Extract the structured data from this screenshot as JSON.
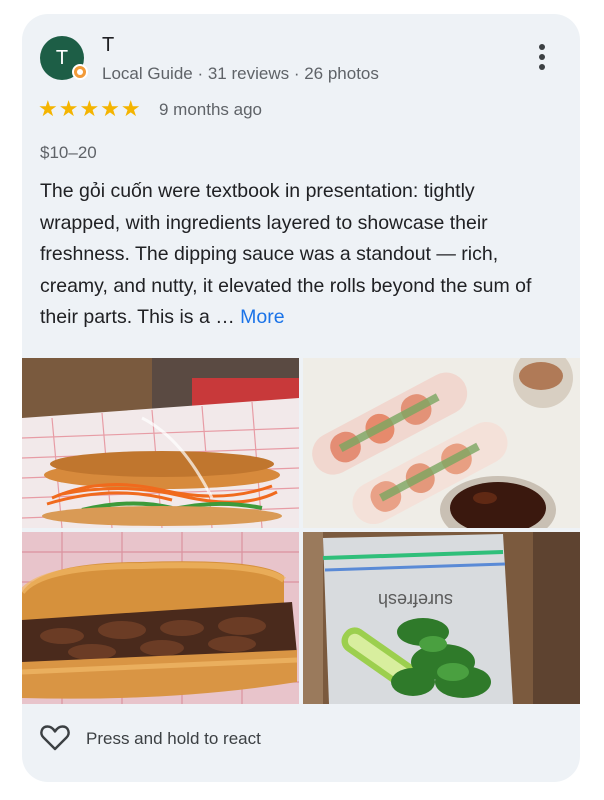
{
  "reviewer": {
    "initial": "T",
    "name": "T",
    "meta": "Local Guide · 31 reviews · 26 photos"
  },
  "rating": {
    "stars": "★★★★★",
    "value": 5,
    "time_ago": "9 months ago"
  },
  "price_range": "$10–20",
  "review": {
    "text": "The gỏi cuốn were textbook in presentation: tightly wrapped, with ingredients layered to showcase their freshness. The dipping sauce was a standout — rich, creamy, and nutty, it elevated the rolls beyond the sum of their parts. This is a …",
    "more_label": "More"
  },
  "photos": {
    "bag_label": "surefresh"
  },
  "footer": {
    "react_label": "Press and hold to react"
  },
  "colors": {
    "card_bg": "#eef2f6",
    "avatar_bg": "#1d5e46",
    "star": "#f4b400",
    "link": "#1a73e8"
  },
  "icons": [
    "local-guide-badge-icon",
    "more-vert-icon",
    "star-icon",
    "heart-outline-icon"
  ]
}
